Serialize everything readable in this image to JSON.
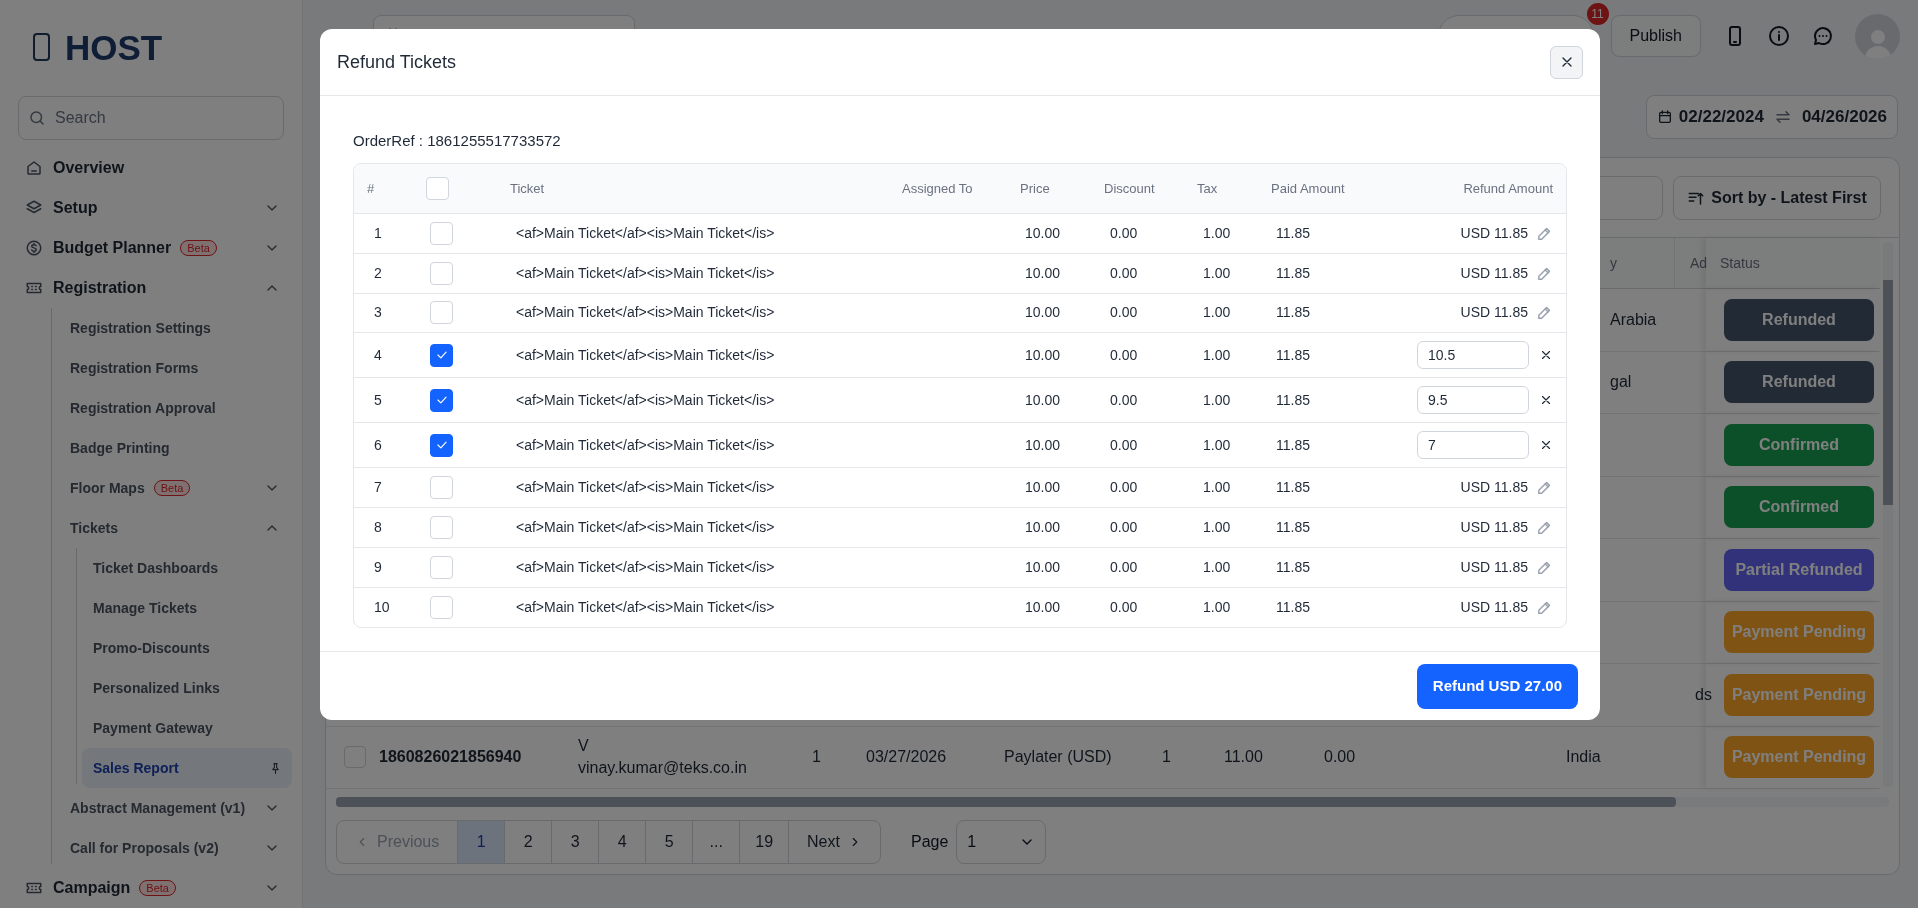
{
  "sidebar": {
    "logo": "HOST",
    "search_placeholder": "Search",
    "items": [
      {
        "kind": "link",
        "label": "Overview",
        "selected": false
      },
      {
        "kind": "group",
        "label": "Setup",
        "expanded": false,
        "selected": false
      },
      {
        "kind": "group",
        "label": "Budget Planner",
        "badge": "Beta",
        "expanded": false,
        "selected": false
      },
      {
        "kind": "group",
        "label": "Registration",
        "expanded": true,
        "selected": false,
        "children": [
          {
            "kind": "link",
            "label": "Registration Settings",
            "selected": false
          },
          {
            "kind": "link",
            "label": "Registration Forms",
            "selected": false
          },
          {
            "kind": "link",
            "label": "Registration Approval",
            "selected": false
          },
          {
            "kind": "link",
            "label": "Badge Printing",
            "selected": false
          },
          {
            "kind": "group",
            "label": "Floor Maps",
            "badge": "Beta",
            "expanded": false,
            "selected": false
          },
          {
            "kind": "group",
            "label": "Tickets",
            "expanded": true,
            "selected": false,
            "children": [
              {
                "kind": "link",
                "label": "Ticket Dashboards",
                "selected": false
              },
              {
                "kind": "link",
                "label": "Manage Tickets",
                "selected": false
              },
              {
                "kind": "link",
                "label": "Promo-Discounts",
                "selected": false
              },
              {
                "kind": "link",
                "label": "Personalized Links",
                "selected": false
              },
              {
                "kind": "link",
                "label": "Payment Gateway",
                "selected": false
              },
              {
                "kind": "link",
                "label": "Sales Report",
                "selected": true
              }
            ]
          },
          {
            "kind": "group",
            "label": "Abstract Management (v1)",
            "expanded": false,
            "selected": false
          },
          {
            "kind": "group",
            "label": "Call for Proposals (v2)",
            "expanded": false,
            "selected": false
          }
        ]
      },
      {
        "kind": "group",
        "label": "Campaign",
        "badge": "Beta",
        "expanded": false,
        "selected": false
      }
    ]
  },
  "topbar": {
    "notification_count": "11",
    "publish": "Publish"
  },
  "date_range": {
    "start": "02/22/2024",
    "end": "04/26/2026"
  },
  "sort_button": "Sort by - Latest First",
  "background_table": {
    "columns": [
      "y",
      "Ad",
      "Status"
    ],
    "rows": [
      {
        "country": "Arabia",
        "status": "Refunded",
        "color": "#222a35"
      },
      {
        "country": "gal",
        "status": "Refunded",
        "color": "#222a35"
      },
      {
        "status": "Confirmed",
        "color": "#0b5028"
      },
      {
        "status": "Confirmed",
        "color": "#0b5028"
      },
      {
        "status": "Partial Refunded",
        "color": "#32327a"
      },
      {
        "status": "Payment Pending",
        "color": "#7f5314"
      },
      {
        "column_ad": "ds",
        "status": "Payment Pending",
        "color": "#7f5314"
      },
      {
        "checked": false,
        "order_ref": "1860826021856940",
        "name": "V",
        "email": "vinay.kumar@teks.co.in",
        "column_3": "1",
        "date": "03/27/2026",
        "payment": "Paylater (USD)",
        "column_6": "1",
        "column_7": "11.00",
        "column_8": "0.00",
        "country": "India",
        "status": "Payment Pending",
        "color": "#7f5314"
      }
    ]
  },
  "pagination": {
    "previous": "Previous",
    "previous_disabled": true,
    "pages": [
      {
        "label": "1",
        "selected": true
      },
      {
        "label": "2",
        "selected": false
      },
      {
        "label": "3",
        "selected": false
      },
      {
        "label": "4",
        "selected": false
      },
      {
        "label": "5",
        "selected": false
      },
      {
        "label": "...",
        "selected": false
      },
      {
        "label": "19",
        "selected": false
      }
    ],
    "next": "Next",
    "page_label": "Page",
    "page_value": "1"
  },
  "modal": {
    "title": "Refund Tickets",
    "order_ref": "OrderRef : 1861255517733572",
    "header_checked": false,
    "columns": [
      "#",
      "Ticket",
      "Assigned To",
      "Price",
      "Discount",
      "Tax",
      "Paid Amount",
      "Refund Amount"
    ],
    "rows": [
      {
        "number": "1",
        "checked": false,
        "ticket": "<af>Main Ticket</af><is>Main Ticket</is>",
        "price": "10.00",
        "discount": "0.00",
        "tax": "1.00",
        "paid": "11.85",
        "kind": "display",
        "refund": "USD 11.85"
      },
      {
        "number": "2",
        "checked": false,
        "ticket": "<af>Main Ticket</af><is>Main Ticket</is>",
        "price": "10.00",
        "discount": "0.00",
        "tax": "1.00",
        "paid": "11.85",
        "kind": "display",
        "refund": "USD 11.85"
      },
      {
        "number": "3",
        "checked": false,
        "ticket": "<af>Main Ticket</af><is>Main Ticket</is>",
        "price": "10.00",
        "discount": "0.00",
        "tax": "1.00",
        "paid": "11.85",
        "kind": "display",
        "refund": "USD 11.85"
      },
      {
        "number": "4",
        "checked": true,
        "ticket": "<af>Main Ticket</af><is>Main Ticket</is>",
        "price": "10.00",
        "discount": "0.00",
        "tax": "1.00",
        "paid": "11.85",
        "kind": "input",
        "refund": "10.5"
      },
      {
        "number": "5",
        "checked": true,
        "ticket": "<af>Main Ticket</af><is>Main Ticket</is>",
        "price": "10.00",
        "discount": "0.00",
        "tax": "1.00",
        "paid": "11.85",
        "kind": "input",
        "refund": "9.5"
      },
      {
        "number": "6",
        "checked": true,
        "ticket": "<af>Main Ticket</af><is>Main Ticket</is>",
        "price": "10.00",
        "discount": "0.00",
        "tax": "1.00",
        "paid": "11.85",
        "kind": "input",
        "refund": "7"
      },
      {
        "number": "7",
        "checked": false,
        "ticket": "<af>Main Ticket</af><is>Main Ticket</is>",
        "price": "10.00",
        "discount": "0.00",
        "tax": "1.00",
        "paid": "11.85",
        "kind": "display",
        "refund": "USD 11.85"
      },
      {
        "number": "8",
        "checked": false,
        "ticket": "<af>Main Ticket</af><is>Main Ticket</is>",
        "price": "10.00",
        "discount": "0.00",
        "tax": "1.00",
        "paid": "11.85",
        "kind": "display",
        "refund": "USD 11.85"
      },
      {
        "number": "9",
        "checked": false,
        "ticket": "<af>Main Ticket</af><is>Main Ticket</is>",
        "price": "10.00",
        "discount": "0.00",
        "tax": "1.00",
        "paid": "11.85",
        "kind": "display",
        "refund": "USD 11.85"
      },
      {
        "number": "10",
        "checked": false,
        "ticket": "<af>Main Ticket</af><is>Main Ticket</is>",
        "price": "10.00",
        "discount": "0.00",
        "tax": "1.00",
        "paid": "11.85",
        "kind": "display",
        "refund": "USD 11.85"
      }
    ],
    "submit": "Refund USD 27.00"
  }
}
